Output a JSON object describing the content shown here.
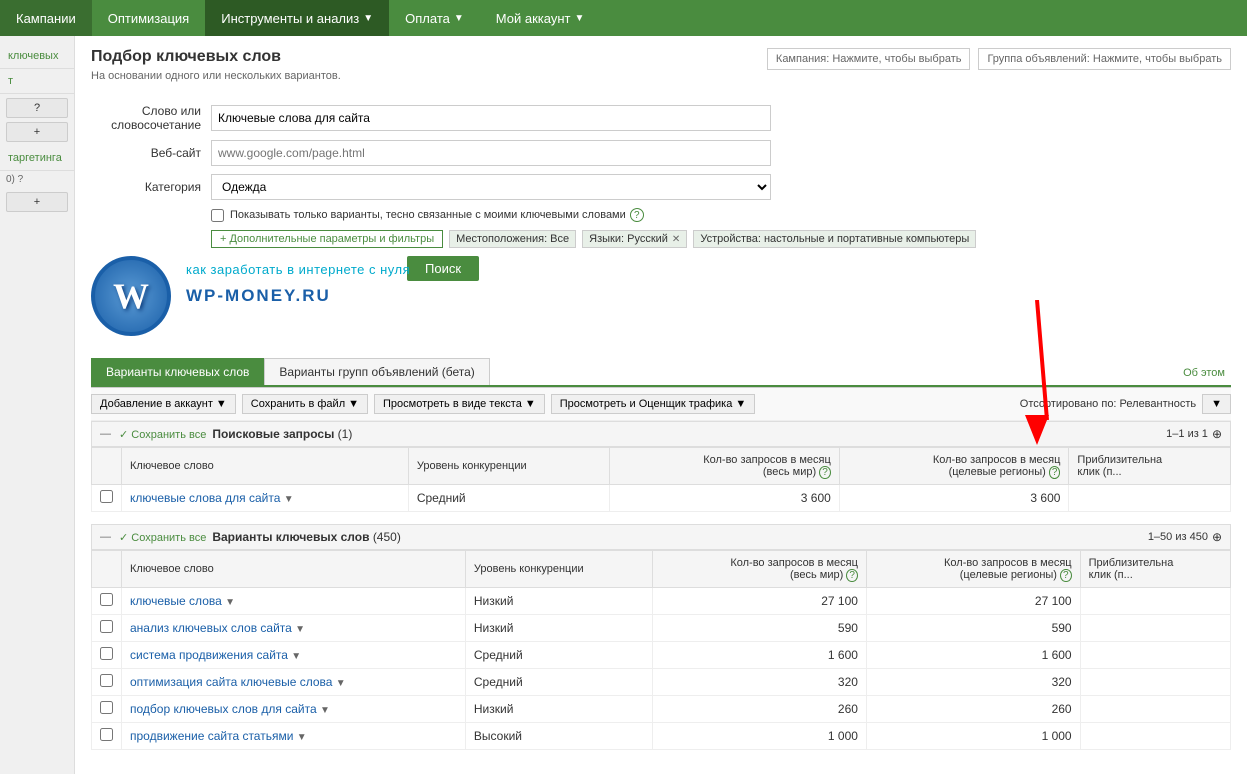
{
  "nav": {
    "items": [
      {
        "label": "Кампании",
        "active": false
      },
      {
        "label": "Оптимизация",
        "active": false
      },
      {
        "label": "Инструменты и анализ",
        "hasArrow": true,
        "active": true
      },
      {
        "label": "Оплата",
        "hasArrow": true,
        "active": false
      },
      {
        "label": "Мой аккаунт",
        "hasArrow": true,
        "active": false
      }
    ]
  },
  "sidebar": {
    "items": [
      {
        "label": "ключевых",
        "type": "link"
      },
      {
        "label": "т",
        "type": "link"
      },
      {
        "label": "таргетинга",
        "type": "link"
      }
    ],
    "buttons": [
      {
        "label": "?"
      },
      {
        "label": "+"
      },
      {
        "label": "0) ?"
      },
      {
        "label": "+"
      }
    ]
  },
  "page": {
    "title": "Подбор ключевых слов",
    "subtitle": "На основании одного или нескольких вариантов."
  },
  "campaign_selector": {
    "campaign_label": "Кампания: Нажмите, чтобы выбрать",
    "adgroup_label": "Группа объявлений: Нажмите, чтобы выбрать"
  },
  "form": {
    "word_label": "Слово или\nсловосочетание",
    "word_value": "Ключевые слова для сайта",
    "website_label": "Веб-сайт",
    "website_placeholder": "www.google.com/page.html",
    "category_label": "Категория",
    "category_value": "Одежда",
    "checkbox_label": "Показывать только варианты, тесно связанные с моими ключевыми словами",
    "filter_btn": "+ Дополнительные параметры и фильтры",
    "location_tag": "Местоположения: Все",
    "language_tag": "Языки: Русский",
    "devices_tag": "Устройства: настольные и портативные компьютеры",
    "search_btn": "Поиск"
  },
  "watermark": {
    "tagline": "как заработать в интернете с нуля",
    "url": "WP-MONEY.RU",
    "logo_letter": "W"
  },
  "tabs": {
    "items": [
      {
        "label": "Варианты ключевых слов",
        "active": true
      },
      {
        "label": "Варианты групп объявлений (бета)",
        "active": false
      }
    ],
    "about_link": "Об этом"
  },
  "toolbar": {
    "add_account_btn": "Добавление в аккаунт",
    "save_file_btn": "Сохранить в файл",
    "view_text_btn": "Просмотреть в виде текста",
    "view_traffic_btn": "Просмотреть и Оценщик трафика",
    "sort_label": "Отсортировано по: Релевантность"
  },
  "search_queries_section": {
    "title": "Поисковые запросы",
    "count": "(1)",
    "pagination": "1–1 из 1",
    "save_all_label": "Сохранить все",
    "columns": [
      {
        "label": "Ключевое слово"
      },
      {
        "label": "Уровень конкуренции"
      },
      {
        "label": "Кол-во запросов в месяц\n(весь мир)"
      },
      {
        "label": "Кол-во запросов в месяц\n(целевые регионы)"
      },
      {
        "label": "Приблизительная\nкликов (п..."
      }
    ],
    "rows": [
      {
        "keyword": "ключевые слова для сайта",
        "competition": "Средний",
        "global_monthly": "3 600",
        "local_monthly": "3 600",
        "approx_cpc": ""
      }
    ]
  },
  "keyword_variants_section": {
    "title": "Варианты ключевых слов",
    "count": "(450)",
    "pagination": "1–50 из 450",
    "save_all_label": "Сохранить все",
    "columns": [
      {
        "label": "Ключевое слово"
      },
      {
        "label": "Уровень конкуренции"
      },
      {
        "label": "Кол-во запросов в месяц\n(весь мир)"
      },
      {
        "label": "Кол-во запросов в месяц\n(целевые регионы)"
      },
      {
        "label": "Приблизительная\nкликов (п..."
      }
    ],
    "rows": [
      {
        "keyword": "ключевые слова",
        "competition": "Низкий",
        "global_monthly": "27 100",
        "local_monthly": "27 100",
        "approx_cpc": ""
      },
      {
        "keyword": "анализ ключевых слов сайта",
        "competition": "Низкий",
        "global_monthly": "590",
        "local_monthly": "590",
        "approx_cpc": ""
      },
      {
        "keyword": "система продвижения сайта",
        "competition": "Средний",
        "global_monthly": "1 600",
        "local_monthly": "1 600",
        "approx_cpc": ""
      },
      {
        "keyword": "оптимизация сайта ключевые слова",
        "competition": "Средний",
        "global_monthly": "320",
        "local_monthly": "320",
        "approx_cpc": ""
      },
      {
        "keyword": "подбор ключевых слов для сайта",
        "competition": "Низкий",
        "global_monthly": "260",
        "local_monthly": "260",
        "approx_cpc": ""
      },
      {
        "keyword": "продвижение сайта статьями",
        "competition": "Высокий",
        "global_monthly": "1 000",
        "local_monthly": "1 000",
        "approx_cpc": ""
      }
    ]
  }
}
